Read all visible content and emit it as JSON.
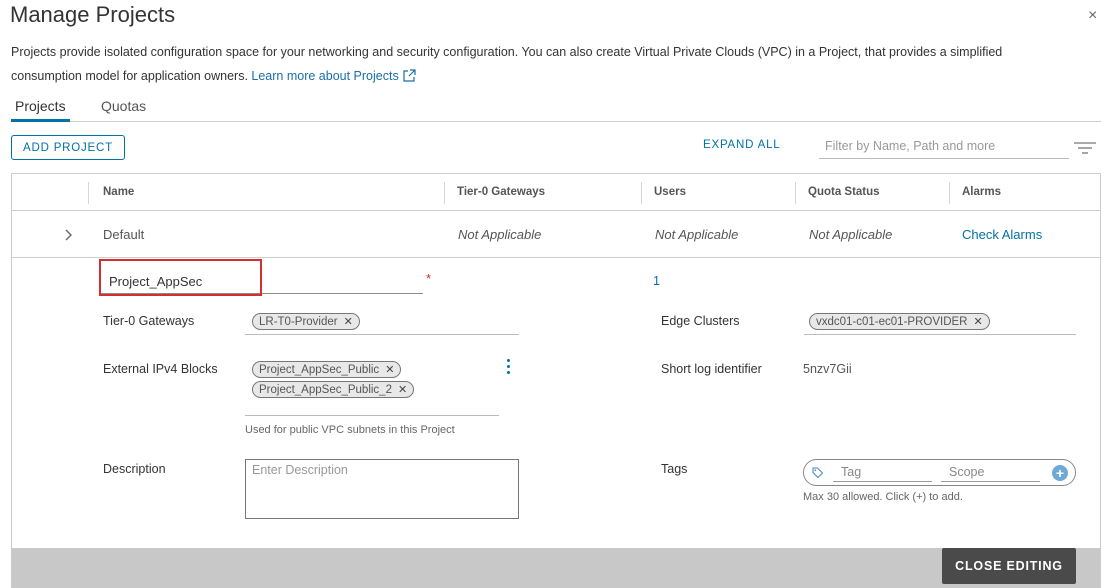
{
  "dialog": {
    "title": "Manage Projects",
    "close_label": "×",
    "description": "Projects provide isolated configuration space for your networking and security configuration. You can also create Virtual Private Clouds (VPC) in a Project, that provides a simplified consumption model for application owners. ",
    "learn_more": "Learn more about Projects"
  },
  "tabs": [
    {
      "label": "Projects",
      "active": true
    },
    {
      "label": "Quotas",
      "active": false
    }
  ],
  "toolbar": {
    "add_project": "ADD PROJECT",
    "expand_all": "EXPAND ALL",
    "filter_placeholder": "Filter by Name, Path and more"
  },
  "table": {
    "columns": [
      "Name",
      "Tier-0 Gateways",
      "Users",
      "Quota Status",
      "Alarms"
    ],
    "rows": [
      {
        "name": "Default",
        "tier0": "Not Applicable",
        "users": "Not Applicable",
        "quota": "Not Applicable",
        "alarms": "Check Alarms"
      }
    ]
  },
  "edit": {
    "name_value": "Project_AppSec",
    "required_mark": "*",
    "users_value": "1",
    "tier0_label": "Tier-0 Gateways",
    "tier0_chips": [
      "LR-T0-Provider"
    ],
    "edge_label": "Edge Clusters",
    "edge_chips": [
      "vxdc01-c01-ec01-PROVIDER"
    ],
    "ipv4_label": "External IPv4 Blocks",
    "ipv4_chips": [
      "Project_AppSec_Public",
      "Project_AppSec_Public_2"
    ],
    "ipv4_hint": "Used for public VPC subnets in this Project",
    "log_label": "Short log identifier",
    "log_value": "5nzv7Gii",
    "desc_label": "Description",
    "desc_placeholder": "Enter Description",
    "tags_label": "Tags",
    "tag_placeholder": "Tag",
    "scope_placeholder": "Scope",
    "tags_hint": "Max 30 allowed. Click (+) to add.",
    "chip_remove": "✕",
    "plus": "+"
  },
  "footer": {
    "close_editing": "CLOSE EDITING"
  },
  "colors": {
    "accent": "#0072a3",
    "required": "#d32f2f",
    "highlight_box": "#d32f2f",
    "footer_button": "#4a4a4a"
  }
}
